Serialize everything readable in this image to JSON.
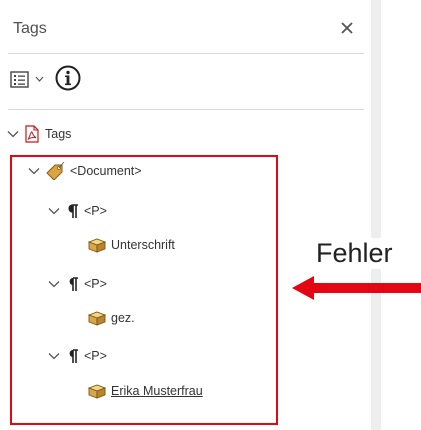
{
  "panel": {
    "title": "Tags",
    "close_icon": "close-icon",
    "options_icon": "options-menu-icon",
    "info_icon": "info-icon"
  },
  "tree": {
    "root": {
      "label": "Tags",
      "icon": "pdf-file-icon",
      "expanded": true
    },
    "document": {
      "label": "<Document>",
      "icon": "tag-label-icon",
      "expanded": true
    },
    "paragraphs": [
      {
        "label": "<P>",
        "icon": "paragraph-icon",
        "expanded": true,
        "child": {
          "label": "Unterschrift",
          "icon": "content-box-icon",
          "underlined": false
        }
      },
      {
        "label": "<P>",
        "icon": "paragraph-icon",
        "expanded": true,
        "child": {
          "label": "gez.",
          "icon": "content-box-icon",
          "underlined": false
        }
      },
      {
        "label": "<P>",
        "icon": "paragraph-icon",
        "expanded": true,
        "child": {
          "label": "Erika Musterfrau ",
          "icon": "content-box-icon",
          "underlined": true
        }
      }
    ]
  },
  "annotation": {
    "label": "Fehler",
    "color": "#e30613"
  }
}
